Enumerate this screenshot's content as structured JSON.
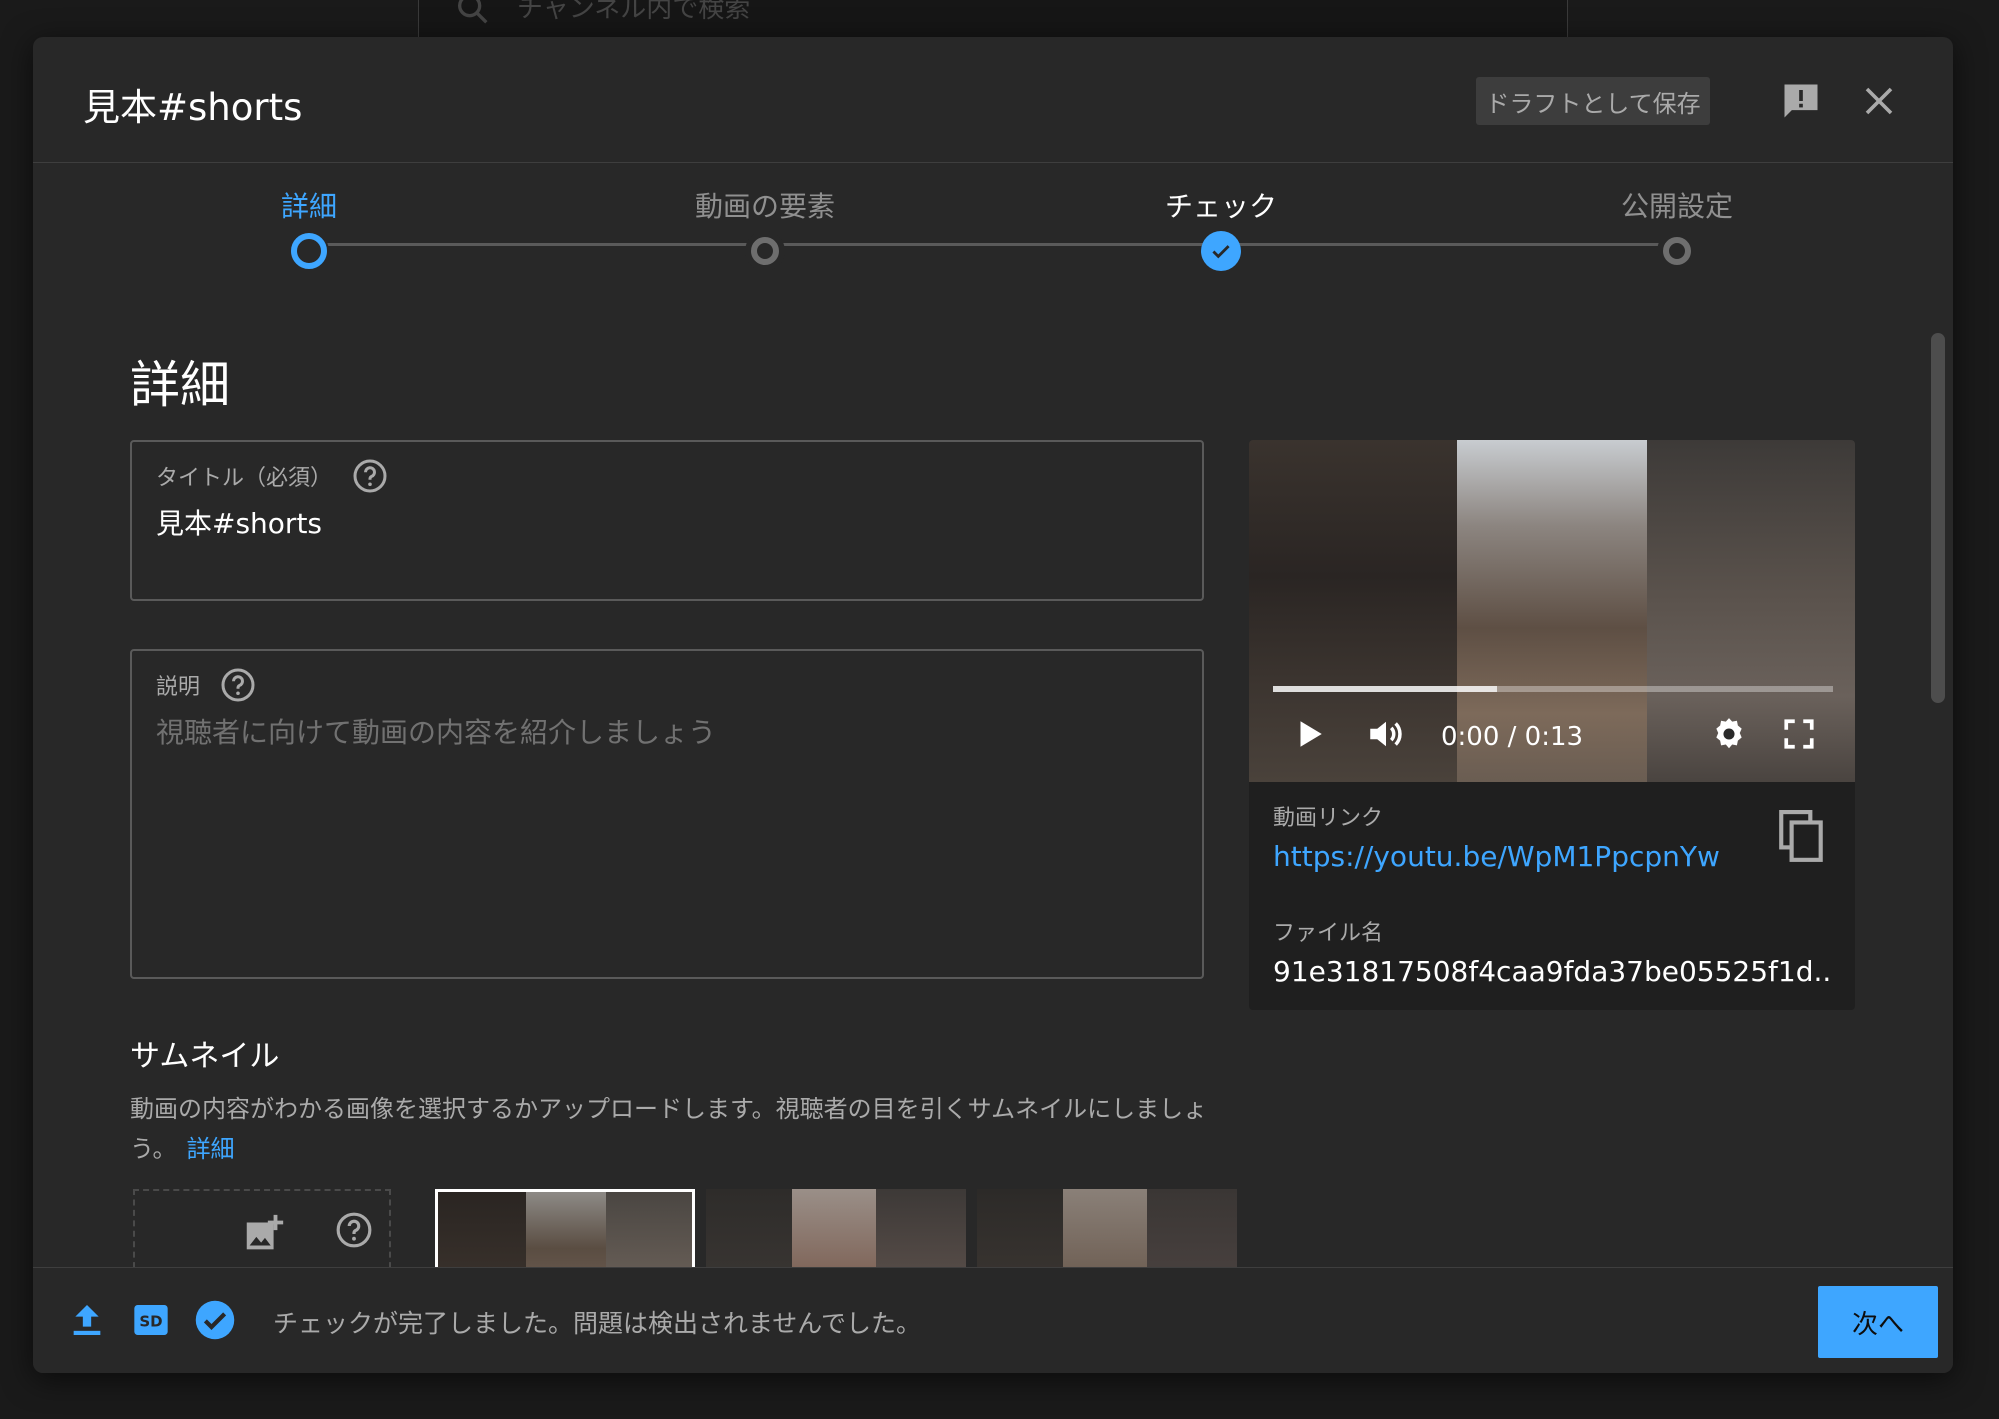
{
  "background": {
    "search_placeholder": "チャンネル内で検索"
  },
  "dialog": {
    "title": "見本#shorts",
    "save_draft_label": "ドラフトとして保存"
  },
  "stepper": {
    "steps": [
      {
        "label": "詳細",
        "state": "active"
      },
      {
        "label": "動画の要素",
        "state": "pending"
      },
      {
        "label": "チェック",
        "state": "checked"
      },
      {
        "label": "公開設定",
        "state": "pending"
      }
    ]
  },
  "details": {
    "heading": "詳細",
    "title_field": {
      "label": "タイトル（必須）",
      "value": "見本#shorts"
    },
    "description_field": {
      "label": "説明",
      "placeholder": "視聴者に向けて動画の内容を紹介しましょう"
    },
    "thumbnail": {
      "heading": "サムネイル",
      "description": "動画の内容がわかる画像を選択するかアップロードします。視聴者の目を引くサムネイルにしましょう。",
      "link": "詳細"
    }
  },
  "video": {
    "time": "0:00 / 0:13",
    "progress": 0.4,
    "link_label": "動画リンク",
    "link_url": "https://youtu.be/WpM1PpcpnYw",
    "filename_label": "ファイル名",
    "filename": "91e31817508f4caa9fda37be05525f1d...."
  },
  "footer": {
    "status": "チェックが完了しました。問題は検出されませんでした。",
    "next_label": "次へ",
    "sd_badge": "SD"
  },
  "colors": {
    "accent": "#3ea6ff",
    "dialog_bg": "#282828",
    "muted_text": "#aaaaaa"
  }
}
